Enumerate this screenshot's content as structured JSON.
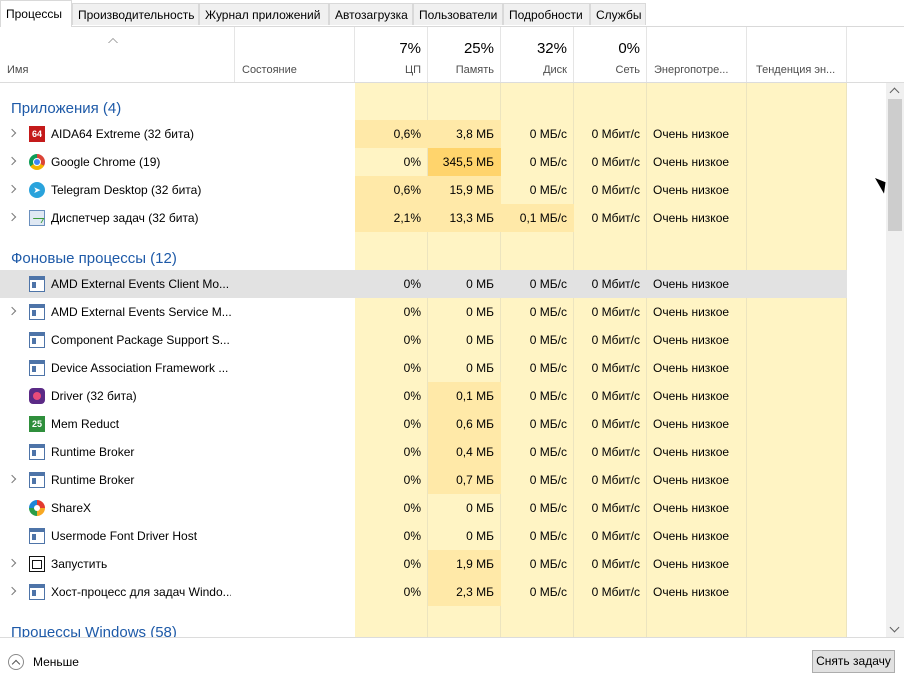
{
  "tabs": [
    "Процессы",
    "Производительность",
    "Журнал приложений",
    "Автозагрузка",
    "Пользователи",
    "Подробности",
    "Службы"
  ],
  "header": {
    "name": "Имя",
    "status": "Состояние",
    "cpu_pct": "7%",
    "cpu": "ЦП",
    "mem_pct": "25%",
    "mem": "Память",
    "disk_pct": "32%",
    "disk": "Диск",
    "net_pct": "0%",
    "net": "Сеть",
    "power": "Энергопотре...",
    "power_trend": "Тенденция эн..."
  },
  "groups": {
    "apps": "Приложения (4)",
    "background": "Фоновые процессы (12)",
    "windows": "Процессы Windows (58)"
  },
  "apps": [
    {
      "name": "AIDA64 Extreme (32 бита)",
      "icon": "aida64-icon",
      "cpu": "0,6%",
      "mem": "3,8 МБ",
      "disk": "0 МБ/с",
      "net": "0 Мбит/с",
      "power": "Очень низкое"
    },
    {
      "name": "Google Chrome (19)",
      "icon": "chrome-icon",
      "cpu": "0%",
      "mem": "345,5 МБ",
      "disk": "0 МБ/с",
      "net": "0 Мбит/с",
      "power": "Очень низкое"
    },
    {
      "name": "Telegram Desktop (32 бита)",
      "icon": "telegram-icon",
      "cpu": "0,6%",
      "mem": "15,9 МБ",
      "disk": "0 МБ/с",
      "net": "0 Мбит/с",
      "power": "Очень низкое"
    },
    {
      "name": "Диспетчер задач (32 бита)",
      "icon": "task-manager-icon",
      "cpu": "2,1%",
      "mem": "13,3 МБ",
      "disk": "0,1 МБ/с",
      "net": "0 Мбит/с",
      "power": "Очень низкое"
    }
  ],
  "background": [
    {
      "name": "AMD External Events Client Mo...",
      "icon": "service-window-icon",
      "cpu": "0%",
      "mem": "0 МБ",
      "disk": "0 МБ/с",
      "net": "0 Мбит/с",
      "power": "Очень низкое"
    },
    {
      "name": "AMD External Events Service M...",
      "icon": "service-window-icon",
      "cpu": "0%",
      "mem": "0 МБ",
      "disk": "0 МБ/с",
      "net": "0 Мбит/с",
      "power": "Очень низкое"
    },
    {
      "name": "Component Package Support S...",
      "icon": "service-window-icon",
      "cpu": "0%",
      "mem": "0 МБ",
      "disk": "0 МБ/с",
      "net": "0 Мбит/с",
      "power": "Очень низкое"
    },
    {
      "name": "Device Association Framework ...",
      "icon": "service-window-icon",
      "cpu": "0%",
      "mem": "0 МБ",
      "disk": "0 МБ/с",
      "net": "0 Мбит/с",
      "power": "Очень низкое"
    },
    {
      "name": "Driver (32 бита)",
      "icon": "driver-icon",
      "cpu": "0%",
      "mem": "0,1 МБ",
      "disk": "0 МБ/с",
      "net": "0 Мбит/с",
      "power": "Очень низкое"
    },
    {
      "name": "Mem Reduct",
      "icon": "mem-reduct-icon",
      "cpu": "0%",
      "mem": "0,6 МБ",
      "disk": "0 МБ/с",
      "net": "0 Мбит/с",
      "power": "Очень низкое"
    },
    {
      "name": "Runtime Broker",
      "icon": "service-window-icon",
      "cpu": "0%",
      "mem": "0,4 МБ",
      "disk": "0 МБ/с",
      "net": "0 Мбит/с",
      "power": "Очень низкое"
    },
    {
      "name": "Runtime Broker",
      "icon": "service-window-icon",
      "cpu": "0%",
      "mem": "0,7 МБ",
      "disk": "0 МБ/с",
      "net": "0 Мбит/с",
      "power": "Очень низкое"
    },
    {
      "name": "ShareX",
      "icon": "sharex-icon",
      "cpu": "0%",
      "mem": "0 МБ",
      "disk": "0 МБ/с",
      "net": "0 Мбит/с",
      "power": "Очень низкое"
    },
    {
      "name": "Usermode Font Driver Host",
      "icon": "service-window-icon",
      "cpu": "0%",
      "mem": "0 МБ",
      "disk": "0 МБ/с",
      "net": "0 Мбит/с",
      "power": "Очень низкое"
    },
    {
      "name": "Запустить",
      "icon": "run-icon",
      "cpu": "0%",
      "mem": "1,9 МБ",
      "disk": "0 МБ/с",
      "net": "0 Мбит/с",
      "power": "Очень низкое"
    },
    {
      "name": "Хост-процесс для задач Windo...",
      "icon": "service-window-icon",
      "cpu": "0%",
      "mem": "2,3 МБ",
      "disk": "0 МБ/с",
      "net": "0 Мбит/с",
      "power": "Очень низкое"
    }
  ],
  "icon_glyphs": {
    "aida64": "64",
    "telegram": "➤",
    "mem_reduct": "25"
  },
  "footer": {
    "less": "Меньше",
    "end_task": "Снять задачу"
  }
}
